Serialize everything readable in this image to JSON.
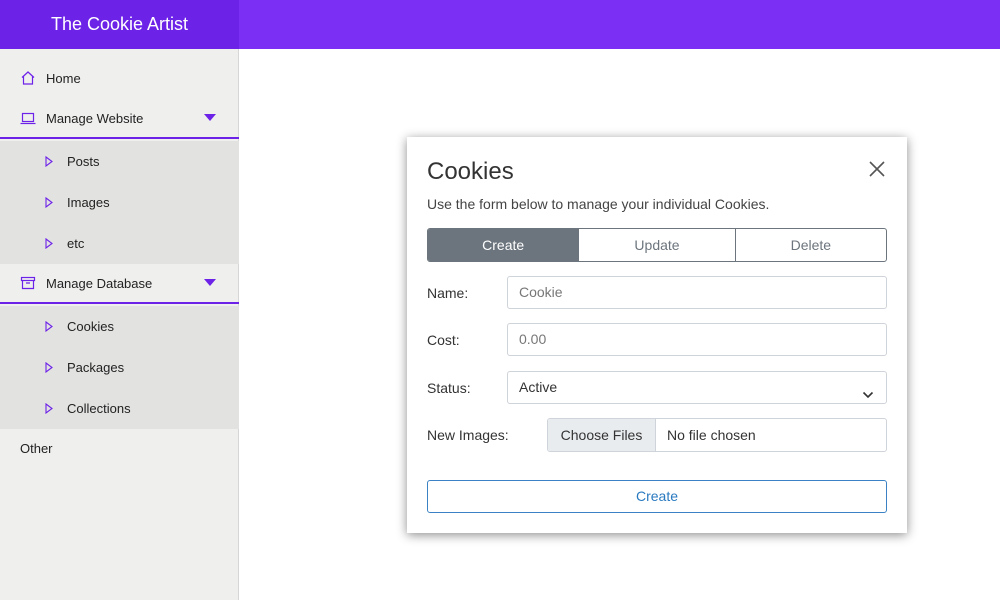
{
  "app": {
    "brand": "The Cookie Artist"
  },
  "sidebar": {
    "home": "Home",
    "manage_website": {
      "label": "Manage Website",
      "items": [
        "Posts",
        "Images",
        "etc"
      ]
    },
    "manage_database": {
      "label": "Manage Database",
      "items": [
        "Cookies",
        "Packages",
        "Collections"
      ]
    },
    "other": "Other"
  },
  "modal": {
    "title": "Cookies",
    "subtitle": "Use the form below to manage your individual Cookies.",
    "tabs": [
      "Create",
      "Update",
      "Delete"
    ],
    "active_tab": "Create",
    "fields": {
      "name": {
        "label": "Name:",
        "placeholder": "Cookie"
      },
      "cost": {
        "label": "Cost:",
        "placeholder": "0.00"
      },
      "status": {
        "label": "Status:",
        "value": "Active"
      },
      "images": {
        "label": "New Images:",
        "button": "Choose Files",
        "text": "No file chosen"
      }
    },
    "submit": "Create"
  },
  "colors": {
    "accent": "#7b2ff5",
    "accent_dark": "#6d22e8",
    "tab_active": "#6c757d",
    "submit": "#2a7ac0"
  },
  "icons": [
    "home-icon",
    "laptop-icon",
    "archive-icon",
    "caret-down-icon",
    "triangle-right-icon",
    "close-icon",
    "chevron-down-icon"
  ]
}
